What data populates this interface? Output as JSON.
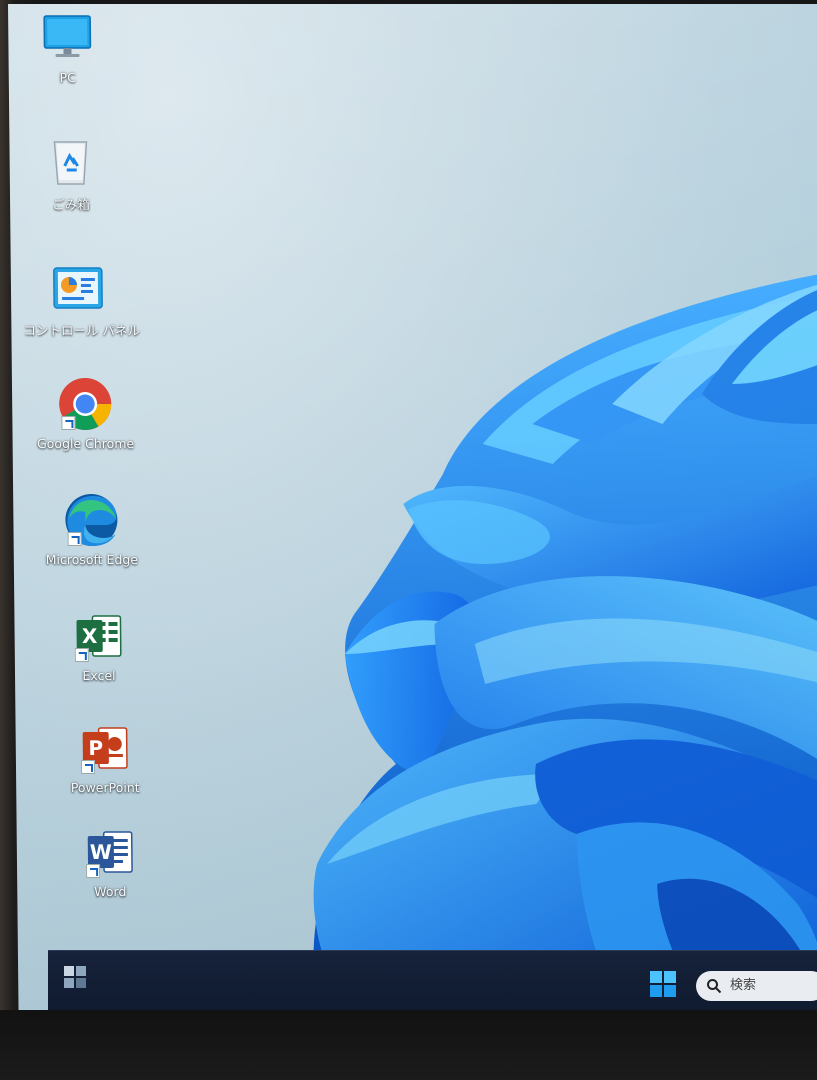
{
  "desktop": {
    "icons": [
      {
        "label": "PC",
        "icon": "pc-monitor-icon"
      },
      {
        "label": "ごみ箱",
        "icon": "recycle-bin-icon"
      },
      {
        "label": "コントロール パネル",
        "icon": "control-panel-icon"
      },
      {
        "label": "Google Chrome",
        "icon": "chrome-icon"
      },
      {
        "label": "Microsoft Edge",
        "icon": "edge-icon"
      },
      {
        "label": "Excel",
        "icon": "excel-icon"
      },
      {
        "label": "PowerPoint",
        "icon": "powerpoint-icon"
      },
      {
        "label": "Word",
        "icon": "word-icon"
      }
    ]
  },
  "taskbar": {
    "search_placeholder": "検索",
    "start_icon": "windows-logo-icon",
    "search_icon": "search-icon"
  },
  "colors": {
    "wallpaper_bloom": "#1e88ff",
    "taskbar_bg": "#101b30",
    "chrome_red": "#db4437",
    "chrome_green": "#0f9d58",
    "chrome_yellow": "#f4b400",
    "chrome_blue": "#4285f4",
    "excel_green": "#1d6f42",
    "powerpoint_orange": "#c43e1c",
    "word_blue": "#2b579a"
  }
}
